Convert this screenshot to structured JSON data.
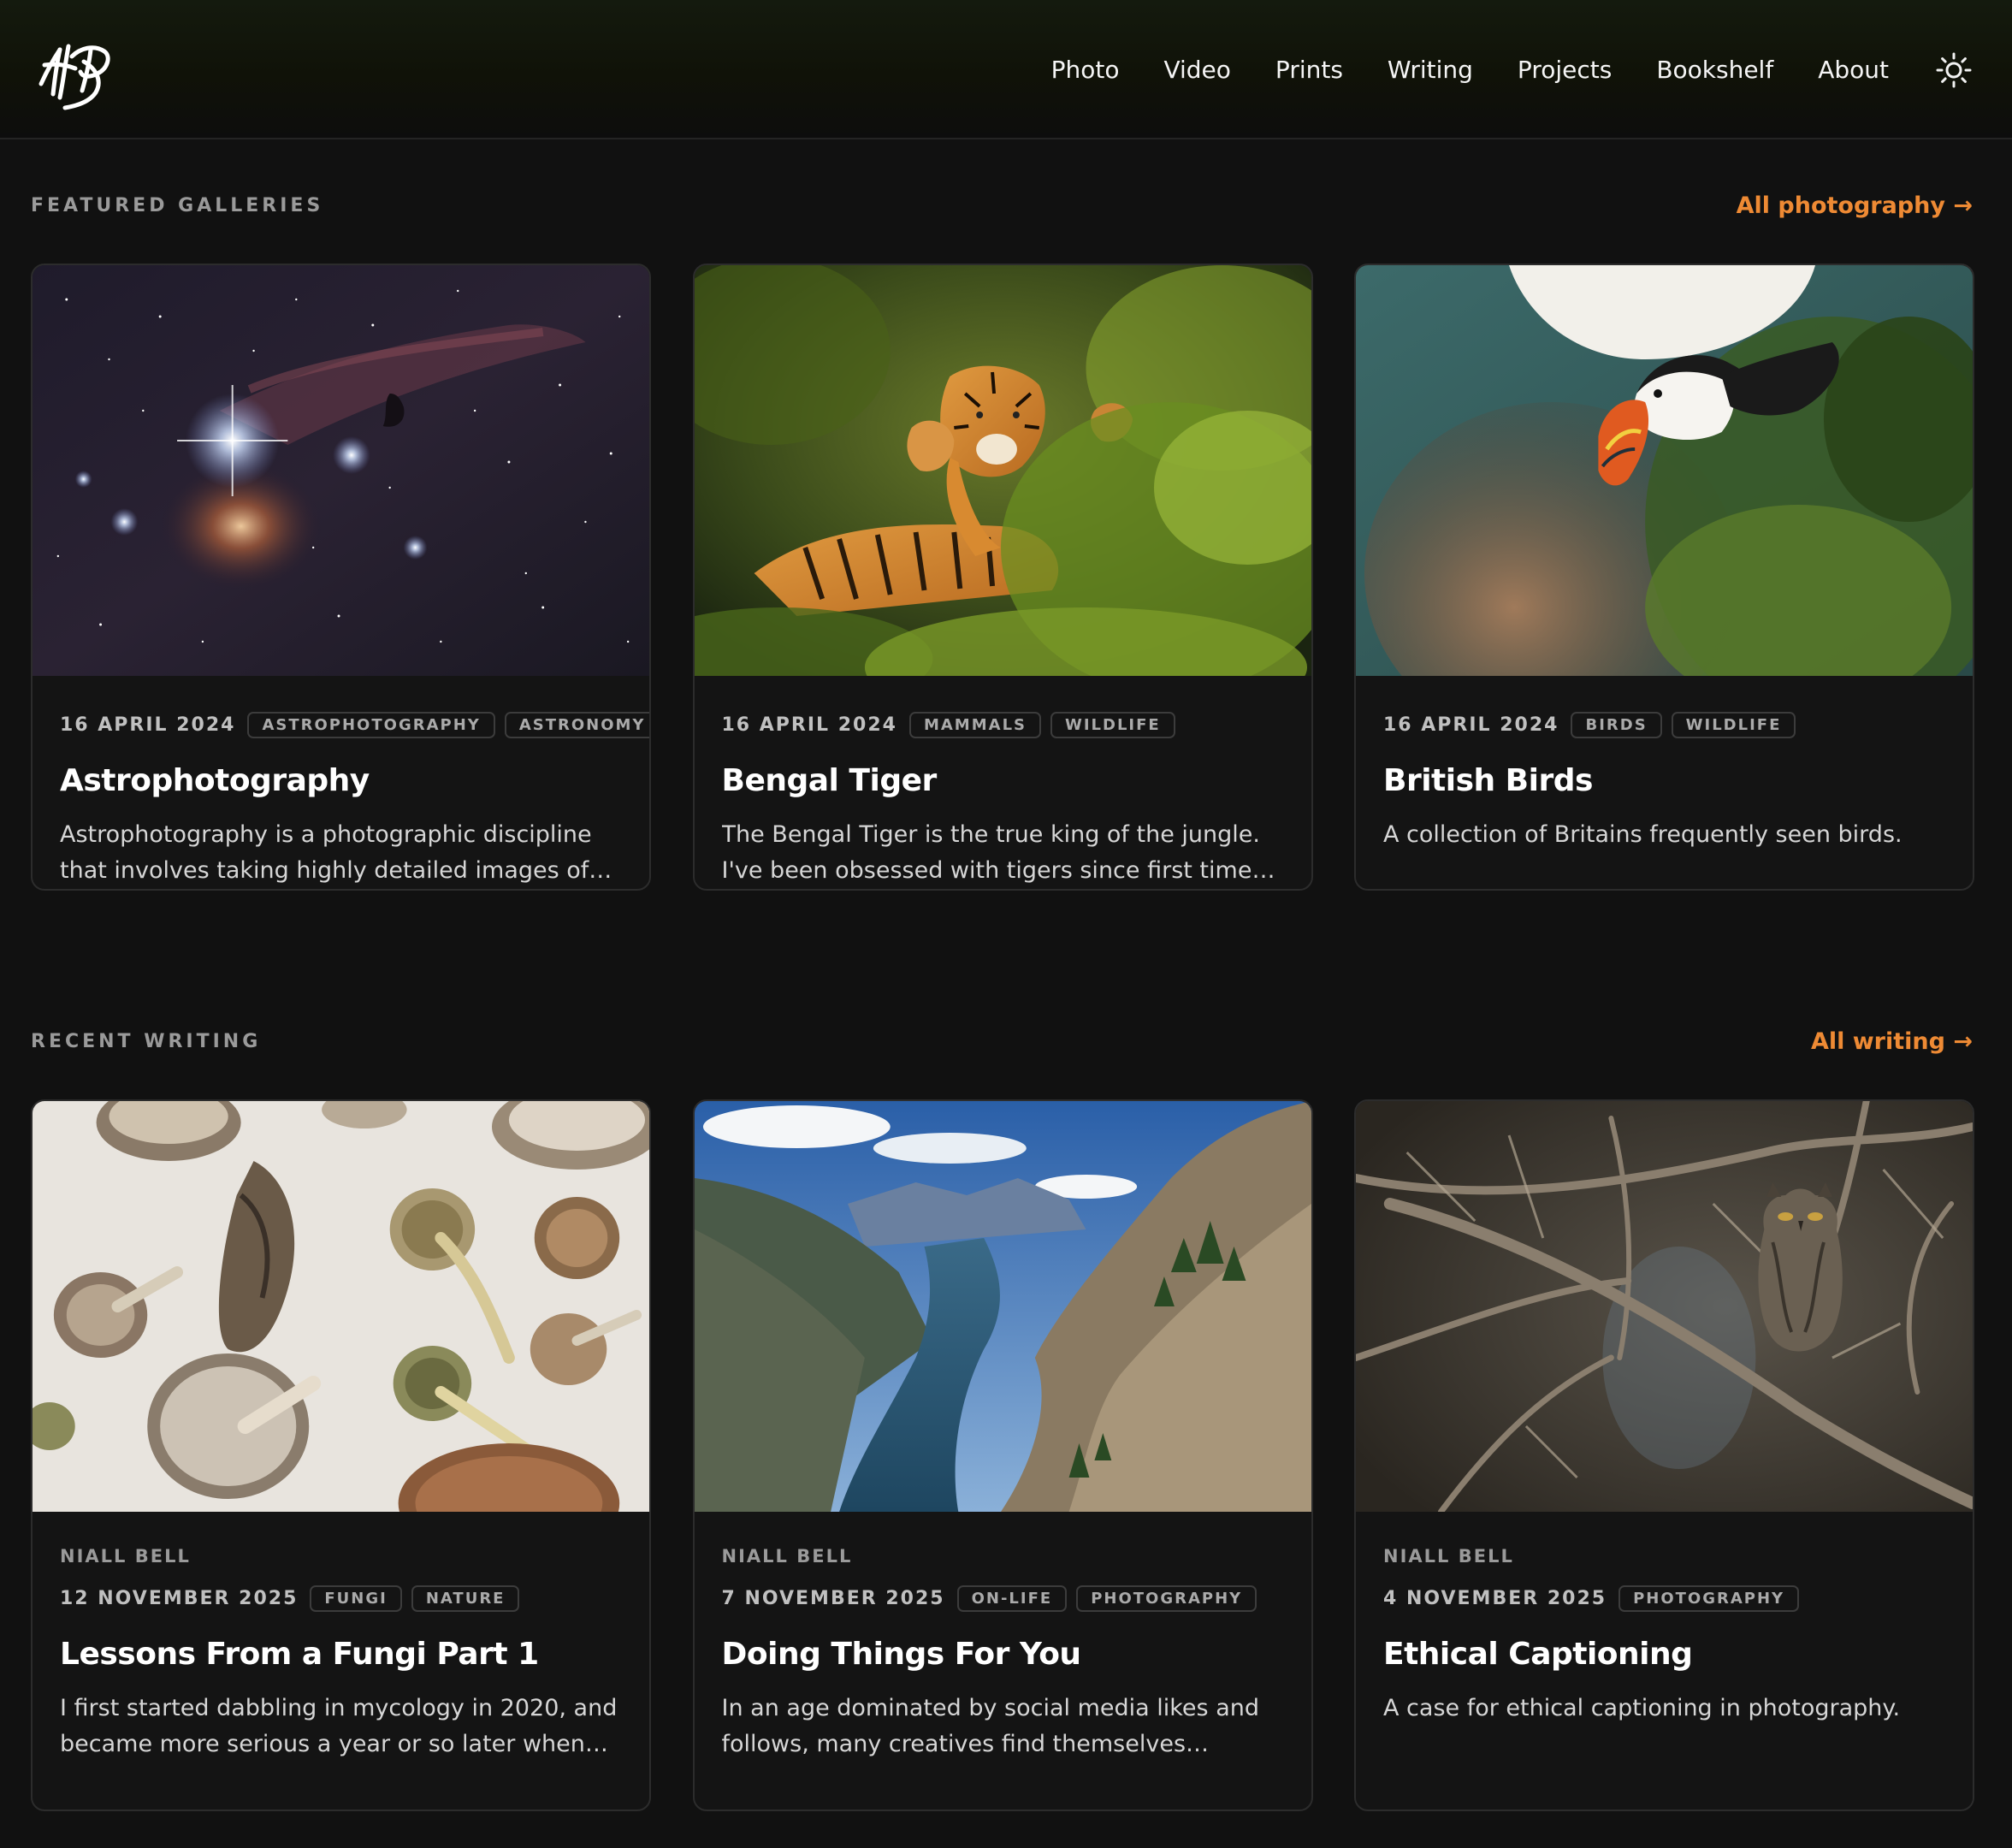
{
  "nav": {
    "items": [
      "Photo",
      "Video",
      "Prints",
      "Writing",
      "Projects",
      "Bookshelf",
      "About"
    ],
    "logo_icon": "signature-logo-icon",
    "theme_icon": "sun-icon"
  },
  "colors": {
    "accent": "#ee8a34",
    "background": "#111111",
    "card": "#141414"
  },
  "galleries": {
    "label": "FEATURED GALLERIES",
    "link": "All photography →",
    "cards": [
      {
        "date": "16 APRIL 2024",
        "tags": [
          "ASTROPHOTOGRAPHY",
          "ASTRONOMY"
        ],
        "title": "Astrophotography",
        "desc": "Astrophotography is a photographic discipline that involves taking highly detailed images of…"
      },
      {
        "date": "16 APRIL 2024",
        "tags": [
          "MAMMALS",
          "WILDLIFE"
        ],
        "title": "Bengal Tiger",
        "desc": "The Bengal Tiger is the true king of the jungle. I've been obsessed with tigers since first time I…"
      },
      {
        "date": "16 APRIL 2024",
        "tags": [
          "BIRDS",
          "WILDLIFE"
        ],
        "title": "British Birds",
        "desc": "A collection of Britains frequently seen birds."
      }
    ]
  },
  "writing": {
    "label": "RECENT WRITING",
    "link": "All writing →",
    "cards": [
      {
        "author": "NIALL BELL",
        "date": "12 NOVEMBER 2025",
        "tags": [
          "FUNGI",
          "NATURE"
        ],
        "title": "Lessons From a Fungi Part 1",
        "desc": "I first started dabbling in mycology in 2020, and became more serious a year or so later when I…"
      },
      {
        "author": "NIALL BELL",
        "date": "7 NOVEMBER 2025",
        "tags": [
          "ON-LIFE",
          "PHOTOGRAPHY"
        ],
        "title": "Doing Things For You",
        "desc": "In an age dominated by social media likes and follows, many creatives find themselves chasin…"
      },
      {
        "author": "NIALL BELL",
        "date": "4 NOVEMBER 2025",
        "tags": [
          "PHOTOGRAPHY"
        ],
        "title": "Ethical Captioning",
        "desc": "A case for ethical captioning in photography."
      }
    ]
  }
}
